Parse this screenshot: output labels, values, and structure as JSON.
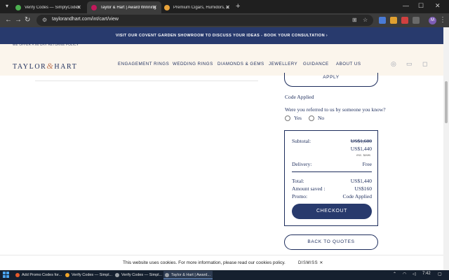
{
  "browser": {
    "tabs": [
      {
        "title": "Verify Codes — SimplyCodes",
        "favicon_color": "#4caf50",
        "active": false
      },
      {
        "title": "Taylor & Hart | Award Winning",
        "favicon_color": "#c2185b",
        "active": true
      },
      {
        "title": "Premium Cigars, Humidors, & Pi",
        "favicon_color": "#e8a23a",
        "active": false
      }
    ],
    "new_tab_icon": "plus-icon",
    "url": "taylorandhart.com/int/cart/view",
    "profile_initial": "M"
  },
  "site": {
    "promo_banner": "VISIT OUR COVENT GARDEN SHOWROOM TO DISCUSS YOUR IDEAS - BOOK YOUR CONSULTATION ›",
    "returns_note": "WE OFFER A 90 DAY RETURNS POLICY",
    "logo": {
      "left": "TAYLOR",
      "amp": "&",
      "right": "HART"
    },
    "nav": [
      "ENGAGEMENT RINGS",
      "WEDDING RINGS",
      "DIAMONDS & GEMS",
      "JEWELLERY",
      "GUIDANCE",
      "ABOUT US"
    ],
    "header_icons": [
      "account-icon",
      "chat-icon",
      "bag-icon"
    ]
  },
  "cart": {
    "apply_label": "APPLY",
    "code_applied": "Code Applied",
    "referral_question": "Were you referred to us by someone you know?",
    "referral_options": [
      "Yes",
      "No"
    ],
    "summary": {
      "subtotal_label": "Subtotal:",
      "subtotal_original": "US$1,600",
      "subtotal_discounted": "US$1,440",
      "tax_note": "exc. taxes",
      "delivery_label": "Delivery:",
      "delivery_value": "Free",
      "total_label": "Total:",
      "total_value": "US$1,440",
      "saved_label": "Amount saved :",
      "saved_value": "US$160",
      "promo_label": "Promo:",
      "promo_value": "Code Applied"
    },
    "checkout_label": "CHECKOUT",
    "back_label": "BACK TO QUOTES"
  },
  "cookie_banner": {
    "text": "This website uses cookies. For more information, please read our cookies policy.",
    "dismiss_label": "DISMISS"
  },
  "taskbar": {
    "items": [
      {
        "label": "Add Promo Codes for...",
        "color": "#e65a2a",
        "active": false
      },
      {
        "label": "Verify Codes — Simpl...",
        "color": "#f0a52a",
        "active": false
      },
      {
        "label": "Verify Codes — Simpl...",
        "color": "#9aa0a6",
        "active": false
      },
      {
        "label": "Taylor & Hart | Award...",
        "color": "#9aa0a6",
        "active": true
      }
    ],
    "time": "7:42"
  }
}
